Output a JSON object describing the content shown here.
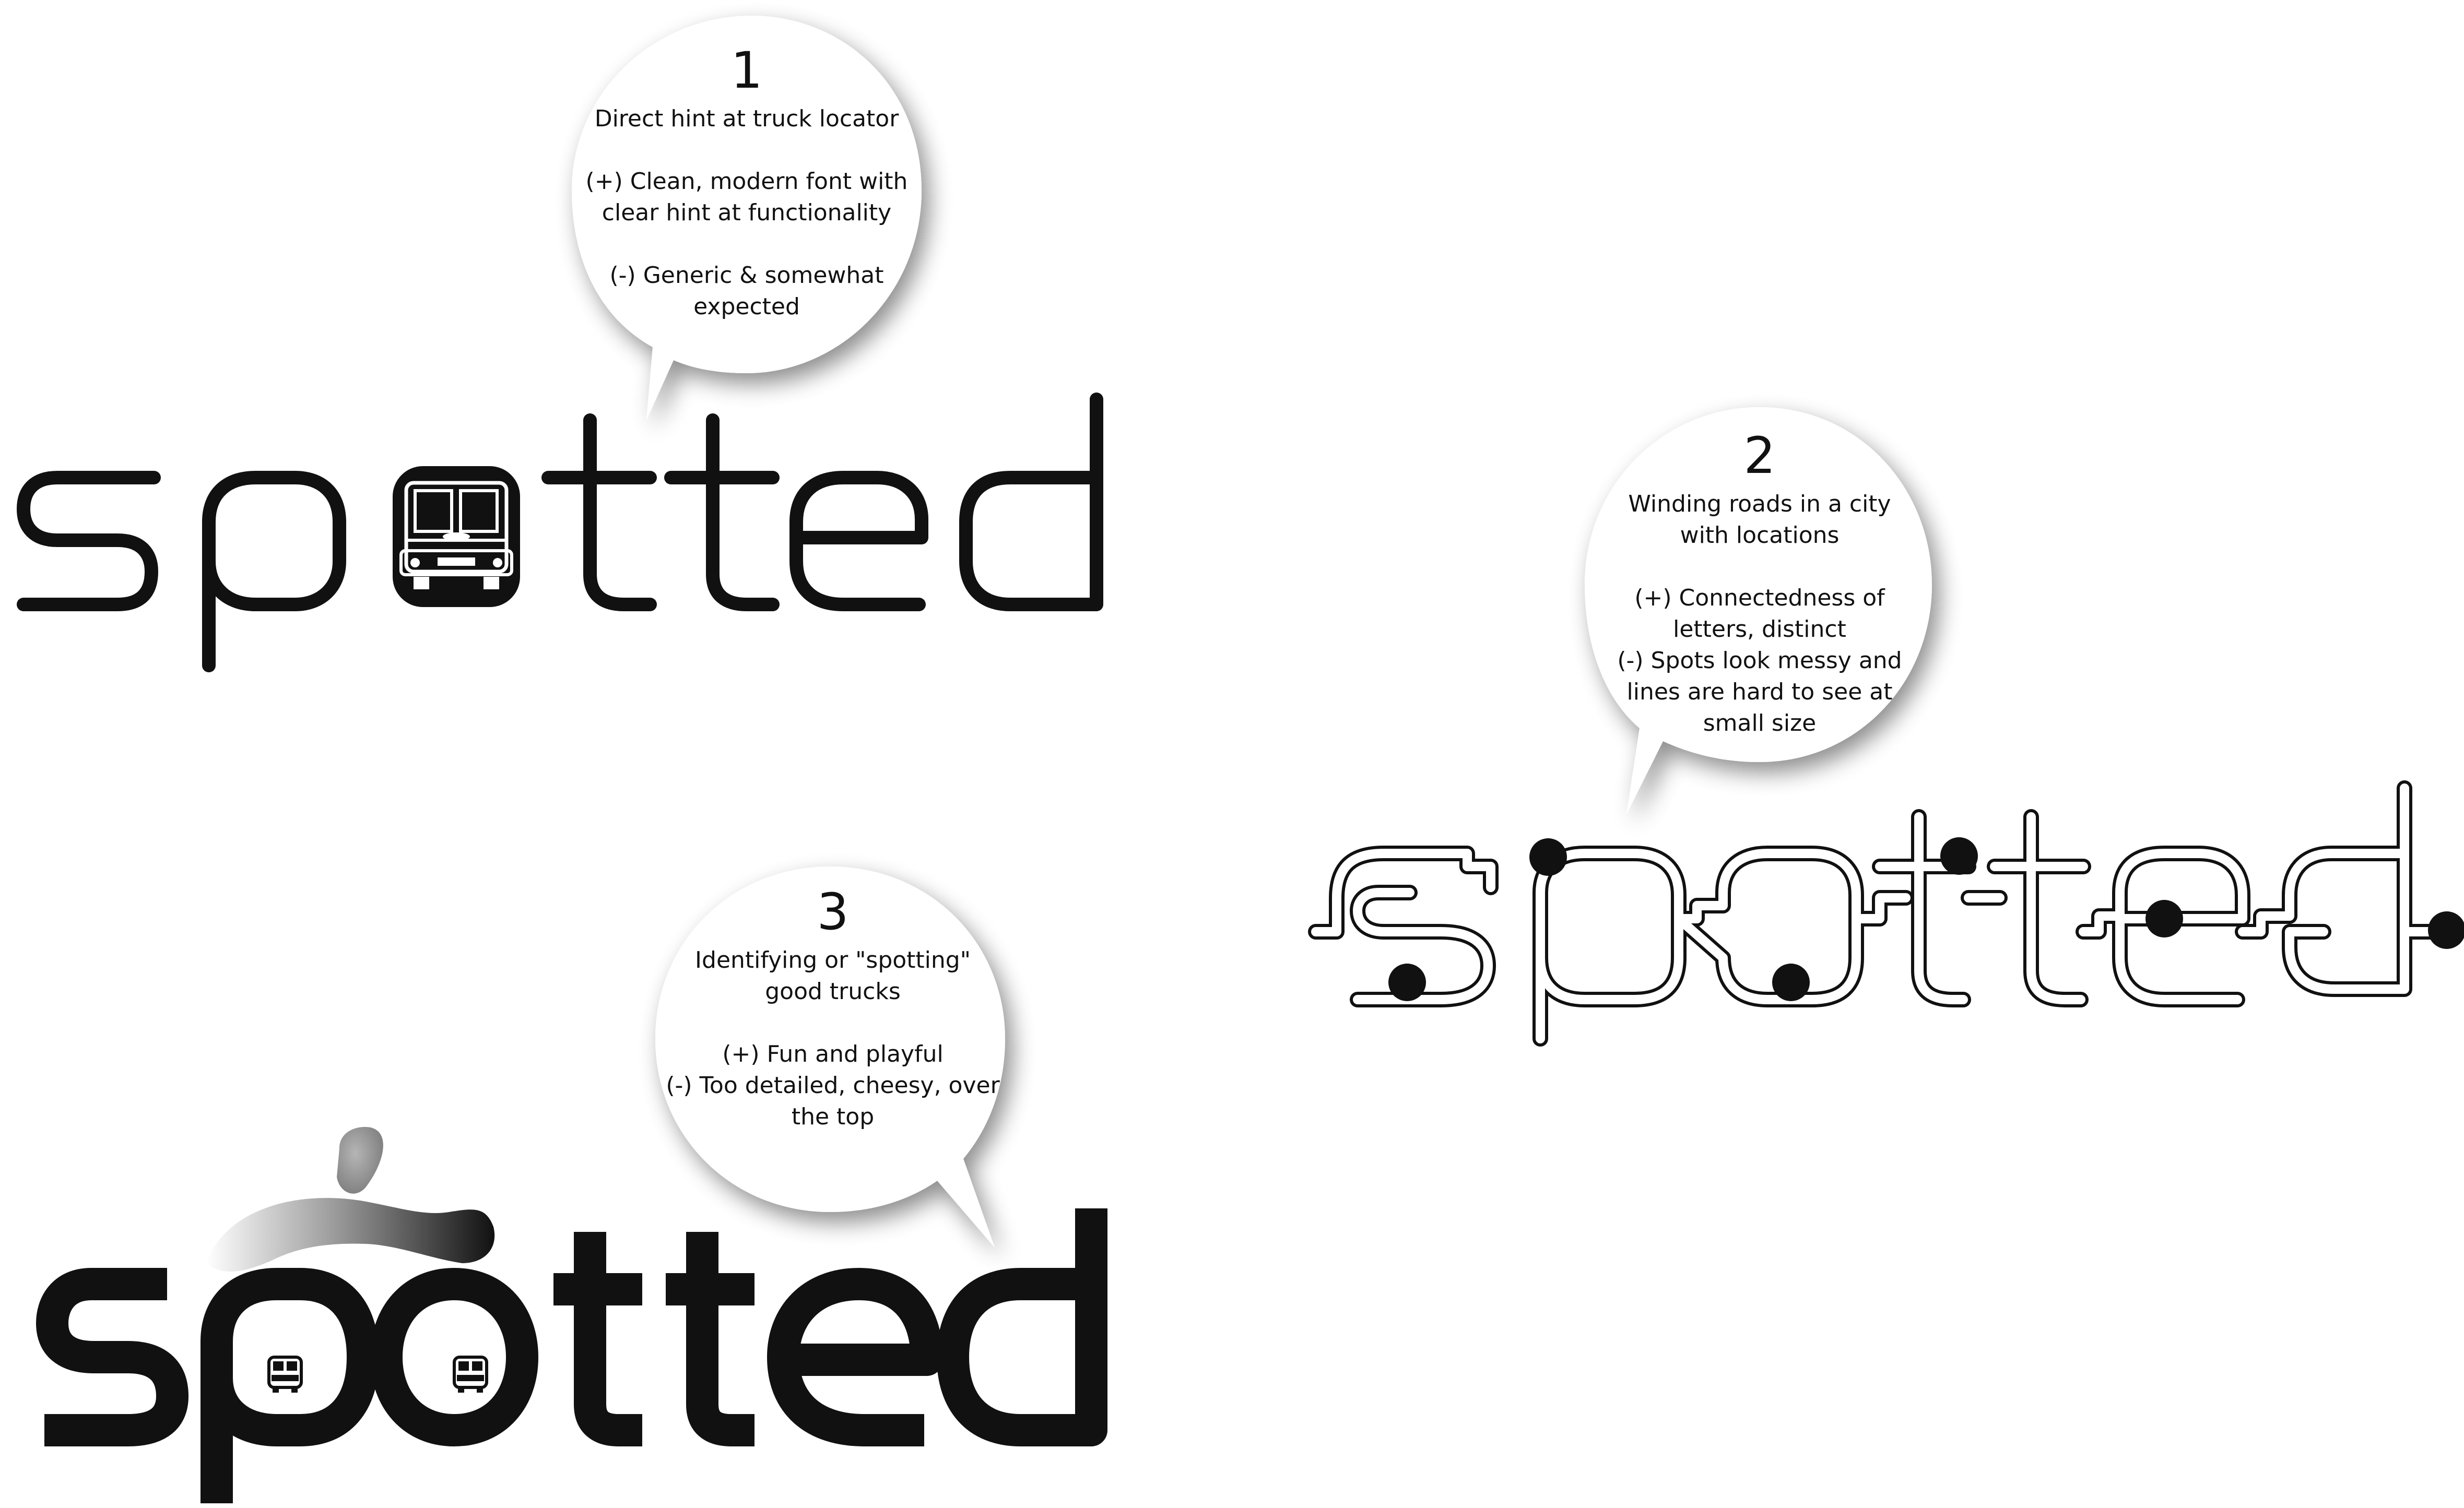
{
  "concepts": [
    {
      "number": "1",
      "lines": [
        "Direct hint at truck locator",
        "",
        "(+) Clean, modern font with",
        "clear hint at functionality",
        "",
        "(-) Generic & somewhat",
        "expected"
      ],
      "logo_text": "spotted",
      "logo_style": "outline truck icon inside the letter o"
    },
    {
      "number": "2",
      "lines": [
        "Winding roads in a city",
        "with locations",
        "",
        "(+) Connectedness of",
        "letters, distinct",
        "(-) Spots look messy and",
        "lines are hard to see at",
        "small size"
      ],
      "logo_text": "spotted",
      "logo_style": "connected outlined letters with map dots"
    },
    {
      "number": "3",
      "lines": [
        "Identifying or \"spotting\"",
        "good trucks",
        "",
        "(+) Fun and playful",
        "(-) Too detailed, cheesy, over",
        "the top"
      ],
      "logo_text": "spotted",
      "logo_style": "bold letters with person figure and truck eyes"
    }
  ],
  "colors": {
    "ink": "#111111",
    "bubble": "#ffffff",
    "shadow": "#bdbdbd",
    "figure_gray": "#8a8a8a"
  },
  "icons": [
    "speech-bubble-icon",
    "food-truck-icon",
    "location-dot-icon",
    "person-figure-icon"
  ]
}
